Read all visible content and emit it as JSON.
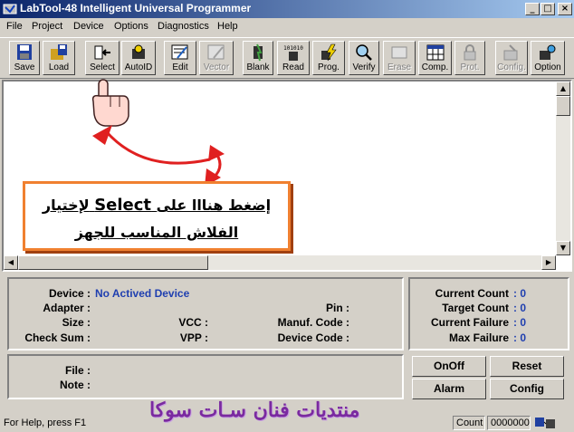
{
  "window": {
    "title": "LabTool-48 Intelligent Universal Programmer",
    "minimize": "_",
    "maximize": "□",
    "close": "×"
  },
  "menu": [
    "File",
    "Project",
    "Device",
    "Options",
    "Diagnostics",
    "Help"
  ],
  "toolbar": [
    {
      "label": "Save",
      "icon": "floppy-disk-icon",
      "enabled": true
    },
    {
      "label": "Load",
      "icon": "folder-load-icon",
      "enabled": true
    },
    {
      "label": "Select",
      "icon": "select-arrow-icon",
      "enabled": true
    },
    {
      "label": "AutoID",
      "icon": "autoid-chip-icon",
      "enabled": true
    },
    {
      "label": "Edit",
      "icon": "edit-pencil-icon",
      "enabled": true
    },
    {
      "label": "Vector",
      "icon": "vector-pencil-icon",
      "enabled": false
    },
    {
      "label": "Blank",
      "icon": "blank-chip-icon",
      "enabled": true
    },
    {
      "label": "Read",
      "icon": "read-binary-icon",
      "enabled": true,
      "icon_text": "101010"
    },
    {
      "label": "Prog.",
      "icon": "program-lightning-icon",
      "enabled": true
    },
    {
      "label": "Verify",
      "icon": "verify-magnifier-icon",
      "enabled": true
    },
    {
      "label": "Erase",
      "icon": "erase-icon",
      "enabled": false
    },
    {
      "label": "Comp.",
      "icon": "compare-grid-icon",
      "enabled": true
    },
    {
      "label": "Prot.",
      "icon": "protect-lock-icon",
      "enabled": false
    },
    {
      "label": "Config.",
      "icon": "config-icon",
      "enabled": false
    },
    {
      "label": "Option",
      "icon": "option-icon",
      "enabled": true
    }
  ],
  "annotation": {
    "line1_before": "إضغط هنااا على",
    "line1_keyword": "Select",
    "line1_after": "لإختيار",
    "line2": "الفلاش المناسب للجهز"
  },
  "device_panel": {
    "device_label": "Device :",
    "device_value": "No Actived Device",
    "adapter_label": "Adapter :",
    "pin_label": "Pin :",
    "size_label": "Size :",
    "vcc_label": "VCC :",
    "manuf_label": "Manuf. Code :",
    "checksum_label": "Check Sum :",
    "vpp_label": "VPP :",
    "devcode_label": "Device Code :",
    "file_label": "File :",
    "note_label": "Note :"
  },
  "counts_panel": {
    "current_count_label": "Current Count",
    "current_count_value": ": 0",
    "target_count_label": "Target Count",
    "target_count_value": ": 0",
    "current_failure_label": "Current Failure",
    "current_failure_value": ": 0",
    "max_failure_label": "Max Failure",
    "max_failure_value": ": 0"
  },
  "buttons": {
    "onoff": "OnOff",
    "reset": "Reset",
    "alarm": "Alarm",
    "config": "Config"
  },
  "status": {
    "help": "For Help, press F1",
    "count_label": "Count",
    "count_value": "0000000"
  },
  "watermark": "منتديات فنان سـات سوكا",
  "colors": {
    "value_blue": "#1f3fb0",
    "callout_border": "#f08030",
    "arrow_red": "#e02020",
    "watermark_purple": "#7a2aa0"
  }
}
